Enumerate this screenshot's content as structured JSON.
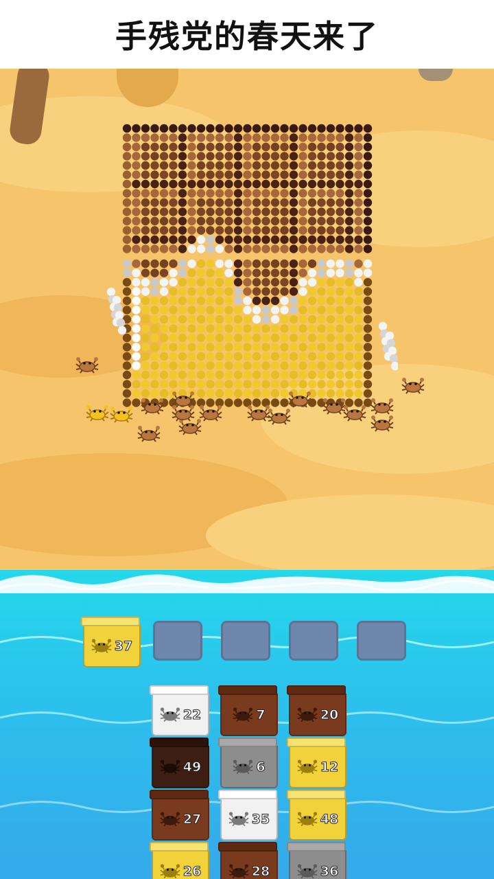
{
  "banner": {
    "title": "手残党的春天来了"
  },
  "colors": {
    "sand": "#f6c46a",
    "sea": "#2bc2ec",
    "slot_empty": "#6f87ad",
    "yellow": "#f2d23a",
    "white": "#f1f1f1",
    "brown": "#7a3a1e",
    "dark_brown": "#3d1e12",
    "gray": "#8d8d8d"
  },
  "active_slots": [
    {
      "count": "37",
      "color": "yellow"
    }
  ],
  "empty_slot_count": 4,
  "box_grid": [
    [
      {
        "count": "22",
        "color": "white"
      },
      {
        "count": "7",
        "color": "brown"
      },
      {
        "count": "20",
        "color": "brown"
      }
    ],
    [
      {
        "count": "49",
        "color": "dark_brown"
      },
      {
        "count": "6",
        "color": "gray"
      },
      {
        "count": "12",
        "color": "yellow"
      }
    ],
    [
      {
        "count": "27",
        "color": "brown"
      },
      {
        "count": "35",
        "color": "white"
      },
      {
        "count": "48",
        "color": "yellow"
      }
    ],
    [
      {
        "count": "26",
        "color": "yellow"
      },
      {
        "count": "28",
        "color": "brown"
      },
      {
        "count": "36",
        "color": "gray"
      }
    ]
  ],
  "picture": {
    "subject": "chocolate-bar",
    "icon": "chocolate-bar-icon"
  }
}
